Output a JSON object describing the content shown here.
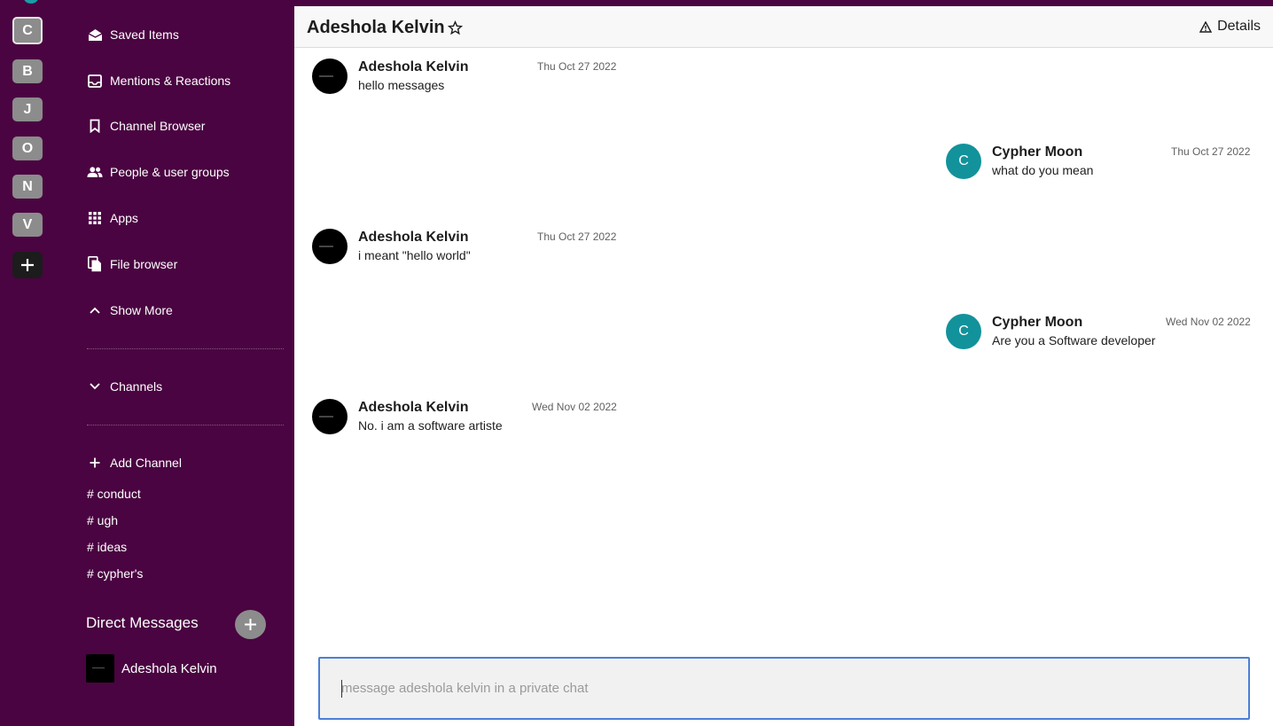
{
  "workspaces": [
    "C",
    "B",
    "J",
    "O",
    "N",
    "V"
  ],
  "sidebar": {
    "nav": [
      {
        "label": "Saved Items",
        "icon": "envelope-open-icon"
      },
      {
        "label": "Mentions & Reactions",
        "icon": "inbox-icon"
      },
      {
        "label": "Channel Browser",
        "icon": "bookmark-icon"
      },
      {
        "label": "People & user groups",
        "icon": "people-icon"
      },
      {
        "label": "Apps",
        "icon": "apps-grid-icon"
      },
      {
        "label": "File browser",
        "icon": "file-copy-icon"
      },
      {
        "label": "Show More",
        "icon": "chevron-up-icon"
      }
    ],
    "channels_toggle": "Channels",
    "add_channel": "Add Channel",
    "channels": [
      "# conduct",
      "# ugh",
      "# ideas",
      "# cypher's"
    ],
    "dm_title": "Direct Messages",
    "dm_users": [
      {
        "name": "Adeshola Kelvin"
      }
    ]
  },
  "header": {
    "title": "Adeshola Kelvin",
    "details_label": "Details"
  },
  "messages": [
    {
      "author": "Adeshola Kelvin",
      "text": "hello messages",
      "date": "Thu Oct 27 2022",
      "side": "left"
    },
    {
      "author": "Cypher Moon",
      "text": "what do you mean",
      "date": "Thu Oct 27 2022",
      "side": "right",
      "initial": "C"
    },
    {
      "author": "Adeshola Kelvin",
      "text": "i meant \"hello world\"",
      "date": "Thu Oct 27 2022",
      "side": "left"
    },
    {
      "author": "Cypher Moon",
      "text": "Are you a Software developer",
      "date": "Wed Nov 02 2022",
      "side": "right",
      "initial": "C"
    },
    {
      "author": "Adeshola Kelvin",
      "text": "No. i am a software artiste",
      "date": "Wed Nov 02 2022",
      "side": "left"
    }
  ],
  "composer": {
    "placeholder": "message adeshola kelvin in a private chat",
    "value": ""
  },
  "colors": {
    "sidebar_bg": "#4a0441",
    "avatar_teal": "#12929b",
    "composer_border": "#4a7fd9"
  }
}
